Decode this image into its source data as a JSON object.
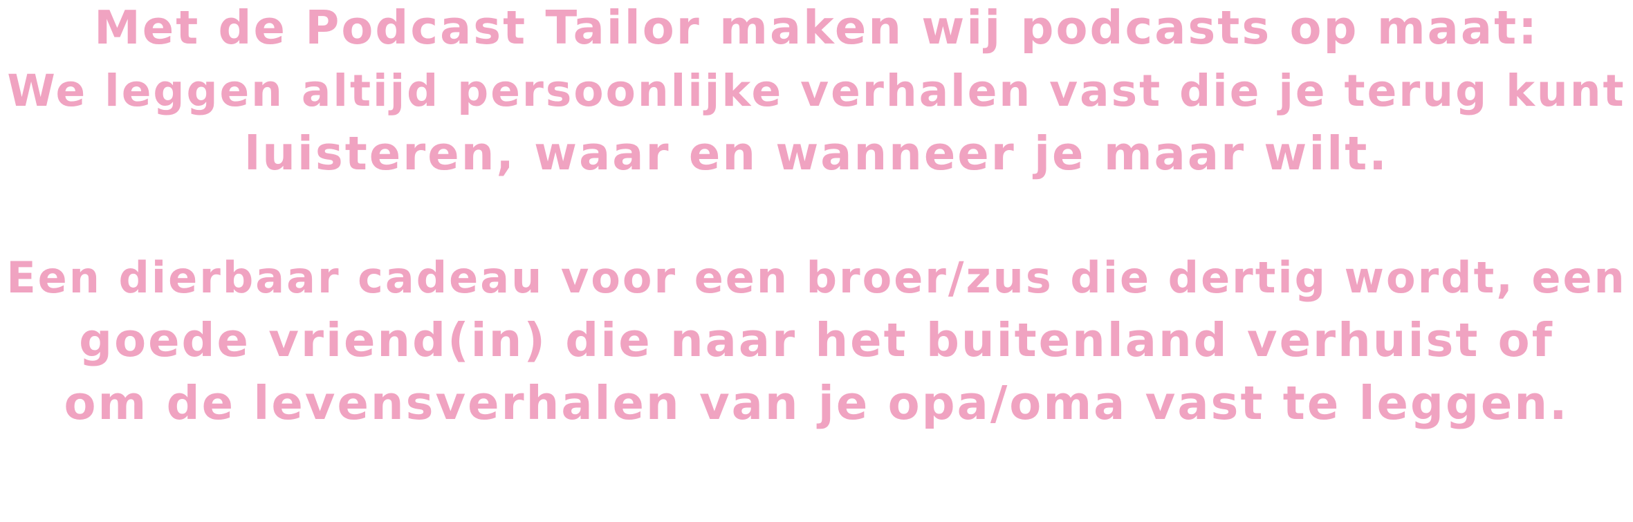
{
  "intro": {
    "lines": [
      "Met de Podcast Tailor maken wij podcasts op maat:",
      "We leggen altijd persoonlijke verhalen vast die je terug kunt",
      "luisteren, waar en wanneer je maar wilt."
    ]
  },
  "gift": {
    "lines": [
      "Een dierbaar cadeau voor een broer/zus die dertig wordt, een",
      "goede vriend(in) die naar het buitenland verhuist of",
      "om de levensverhalen van je opa/oma vast te leggen."
    ]
  },
  "colors": {
    "text": "#f0a3c1",
    "background": "#ffffff"
  }
}
